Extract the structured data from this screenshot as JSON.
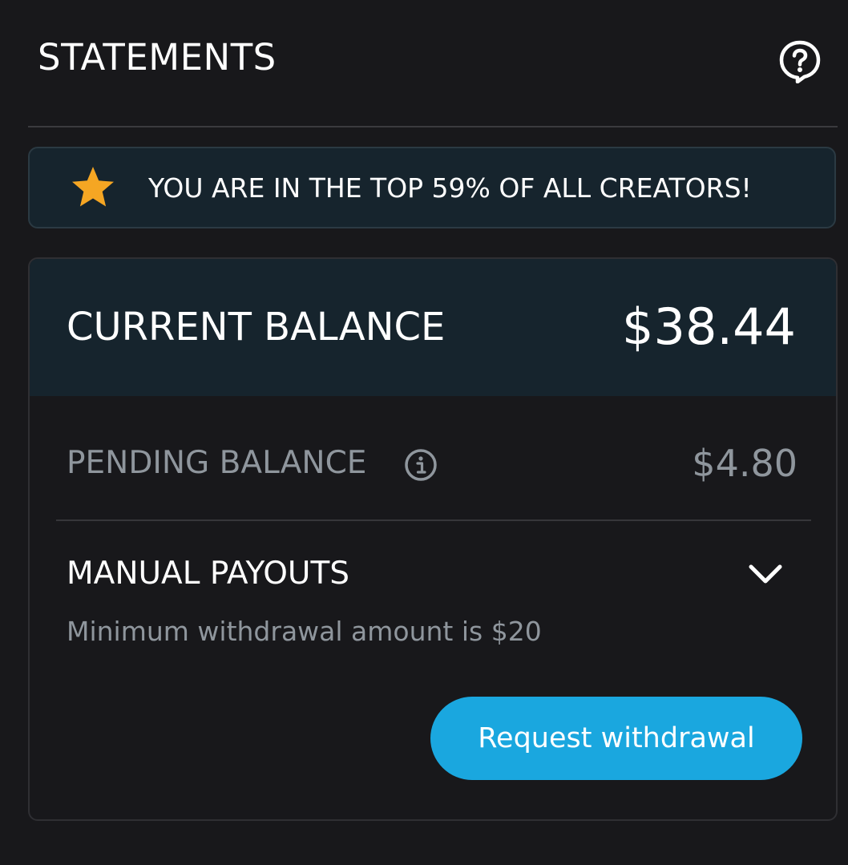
{
  "header": {
    "title": "STATEMENTS",
    "help_icon": "question-bubble-icon"
  },
  "banner": {
    "icon": "star-icon",
    "text": "YOU ARE IN THE TOP 59% OF ALL CREATORS!",
    "star_color": "#f5a623"
  },
  "balance": {
    "current_label": "CURRENT BALANCE",
    "current_amount": "$38.44",
    "pending_label": "PENDING BALANCE",
    "pending_amount": "$4.80",
    "info_icon": "info-icon"
  },
  "payouts": {
    "label": "MANUAL PAYOUTS",
    "chevron_icon": "chevron-down-icon",
    "minimum_text": "Minimum withdrawal amount is $20",
    "button_label": "Request withdrawal",
    "button_color": "#1aa7df"
  }
}
